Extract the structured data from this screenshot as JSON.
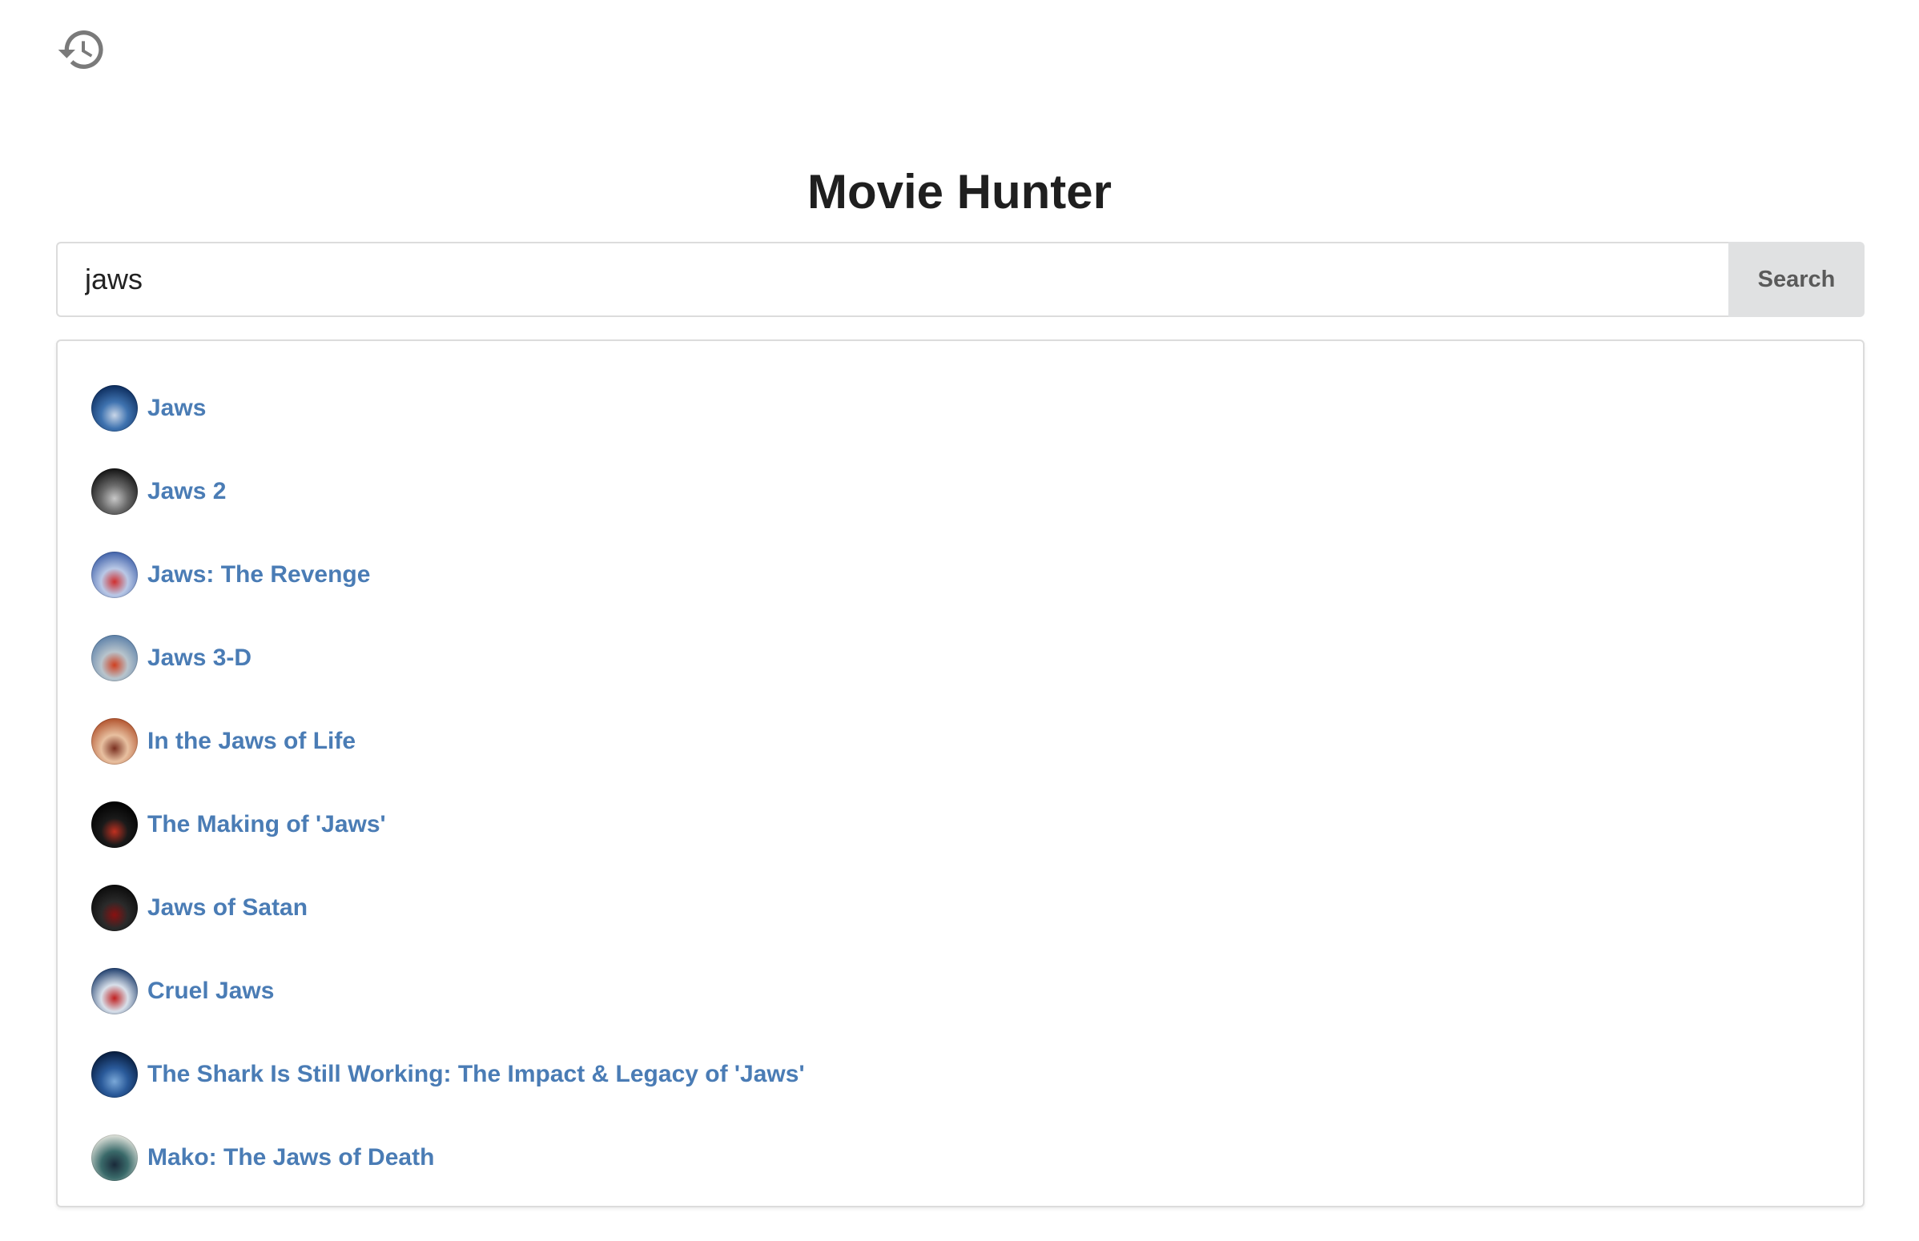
{
  "header": {
    "history_icon": "history-icon",
    "title": "Movie Hunter"
  },
  "search": {
    "value": "jaws",
    "button_label": "Search"
  },
  "results": [
    {
      "title": "Jaws",
      "poster_colors": [
        "#0b2a5a",
        "#3f73b0",
        "#c9d6e8"
      ]
    },
    {
      "title": "Jaws 2",
      "poster_colors": [
        "#101010",
        "#6a6a6a",
        "#c8c8c8"
      ]
    },
    {
      "title": "Jaws: The Revenge",
      "poster_colors": [
        "#3d5fa8",
        "#b9c8e6",
        "#d03030"
      ]
    },
    {
      "title": "Jaws 3-D",
      "poster_colors": [
        "#5a7fa8",
        "#b8c4cc",
        "#d04020"
      ]
    },
    {
      "title": "In the Jaws of Life",
      "poster_colors": [
        "#b0502a",
        "#e8c0a0",
        "#7a3020"
      ]
    },
    {
      "title": "The Making of 'Jaws'",
      "poster_colors": [
        "#000000",
        "#1a1a1a",
        "#c03020"
      ]
    },
    {
      "title": "Jaws of Satan",
      "poster_colors": [
        "#0a0a0a",
        "#2a2a2a",
        "#8a1010"
      ]
    },
    {
      "title": "Cruel Jaws",
      "poster_colors": [
        "#1a3a6a",
        "#d8e0ea",
        "#c02020"
      ]
    },
    {
      "title": "The Shark Is Still Working: The Impact & Legacy of 'Jaws'",
      "poster_colors": [
        "#061a3a",
        "#2a5a9a",
        "#7aa8d8"
      ]
    },
    {
      "title": "Mako: The Jaws of Death",
      "poster_colors": [
        "#e8e8e0",
        "#3a6a6a",
        "#1a2a3a"
      ]
    }
  ]
}
